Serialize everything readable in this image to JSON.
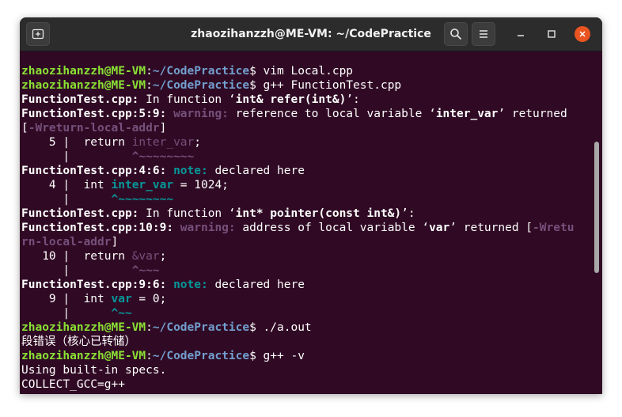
{
  "window": {
    "title": "zhaozihanzzh@ME-VM: ~/CodePractice",
    "icons": [
      "new-tab-icon",
      "search-icon",
      "hamburger-menu-icon",
      "minimize-icon",
      "maximize-icon",
      "close-icon"
    ]
  },
  "colors": {
    "terminal_bg": "#300a24",
    "prompt_user": "#8ae234",
    "prompt_path": "#729fcf",
    "warning": "#75507b",
    "note": "#06989a",
    "close_button": "#e95420"
  },
  "terminal": {
    "lines": [
      [
        {
          "c": "g",
          "t": "zhaozihanzzh@ME-VM"
        },
        {
          "c": "",
          "t": ":"
        },
        {
          "c": "b",
          "t": "~/CodePractice"
        },
        {
          "c": "",
          "t": "$ vim Local.cpp"
        }
      ],
      [
        {
          "c": "g",
          "t": "zhaozihanzzh@ME-VM"
        },
        {
          "c": "",
          "t": ":"
        },
        {
          "c": "b",
          "t": "~/CodePractice"
        },
        {
          "c": "",
          "t": "$ g++ FunctionTest.cpp"
        }
      ],
      [
        {
          "c": "w",
          "t": "FunctionTest.cpp:"
        },
        {
          "c": "",
          "t": " In function ‘"
        },
        {
          "c": "w",
          "t": "int& refer(int&)"
        },
        {
          "c": "",
          "t": "’:"
        }
      ],
      [
        {
          "c": "w",
          "t": "FunctionTest.cpp:5:9:"
        },
        {
          "c": "",
          "t": " "
        },
        {
          "c": "m",
          "t": "warning:"
        },
        {
          "c": "",
          "t": " reference to local variable ‘"
        },
        {
          "c": "w",
          "t": "inter_var"
        },
        {
          "c": "",
          "t": "’ returned"
        }
      ],
      [
        {
          "c": "",
          "t": "["
        },
        {
          "c": "m",
          "t": "-Wreturn-local-addr"
        },
        {
          "c": "",
          "t": "]"
        }
      ],
      [
        {
          "c": "",
          "t": "    5 |  return "
        },
        {
          "c": "pl",
          "t": "inter_var"
        },
        {
          "c": "",
          "t": ";"
        }
      ],
      [
        {
          "c": "",
          "t": "      |         "
        },
        {
          "c": "m",
          "t": "^~~~~~~~~"
        }
      ],
      [
        {
          "c": "w",
          "t": "FunctionTest.cpp:4:6:"
        },
        {
          "c": "",
          "t": " "
        },
        {
          "c": "t",
          "t": "note:"
        },
        {
          "c": "",
          "t": " declared here"
        }
      ],
      [
        {
          "c": "",
          "t": "    4 |  int "
        },
        {
          "c": "t",
          "t": "inter_var"
        },
        {
          "c": "",
          "t": " = 1024;"
        }
      ],
      [
        {
          "c": "",
          "t": "      |      "
        },
        {
          "c": "t",
          "t": "^~~~~~~~~"
        }
      ],
      [
        {
          "c": "w",
          "t": "FunctionTest.cpp:"
        },
        {
          "c": "",
          "t": " In function ‘"
        },
        {
          "c": "w",
          "t": "int* pointer(const int&)"
        },
        {
          "c": "",
          "t": "’:"
        }
      ],
      [
        {
          "c": "w",
          "t": "FunctionTest.cpp:10:9:"
        },
        {
          "c": "",
          "t": " "
        },
        {
          "c": "m",
          "t": "warning:"
        },
        {
          "c": "",
          "t": " address of local variable ‘"
        },
        {
          "c": "w",
          "t": "var"
        },
        {
          "c": "",
          "t": "’ returned ["
        },
        {
          "c": "m",
          "t": "-Wretu"
        }
      ],
      [
        {
          "c": "m",
          "t": "rn-local-addr"
        },
        {
          "c": "",
          "t": "]"
        }
      ],
      [
        {
          "c": "",
          "t": "   10 |  return "
        },
        {
          "c": "pl",
          "t": "&var"
        },
        {
          "c": "",
          "t": ";"
        }
      ],
      [
        {
          "c": "",
          "t": "      |         "
        },
        {
          "c": "m",
          "t": "^~~~"
        }
      ],
      [
        {
          "c": "w",
          "t": "FunctionTest.cpp:9:6:"
        },
        {
          "c": "",
          "t": " "
        },
        {
          "c": "t",
          "t": "note:"
        },
        {
          "c": "",
          "t": " declared here"
        }
      ],
      [
        {
          "c": "",
          "t": "    9 |  int "
        },
        {
          "c": "t",
          "t": "var"
        },
        {
          "c": "",
          "t": " = 0;"
        }
      ],
      [
        {
          "c": "",
          "t": "      |      "
        },
        {
          "c": "t",
          "t": "^~~"
        }
      ],
      [
        {
          "c": "g",
          "t": "zhaozihanzzh@ME-VM"
        },
        {
          "c": "",
          "t": ":"
        },
        {
          "c": "b",
          "t": "~/CodePractice"
        },
        {
          "c": "",
          "t": "$ ./a.out"
        }
      ],
      [
        {
          "c": "",
          "t": "段错误（核心已转储）"
        }
      ],
      [
        {
          "c": "g",
          "t": "zhaozihanzzh@ME-VM"
        },
        {
          "c": "",
          "t": ":"
        },
        {
          "c": "b",
          "t": "~/CodePractice"
        },
        {
          "c": "",
          "t": "$ g++ -v"
        }
      ],
      [
        {
          "c": "",
          "t": "Using built-in specs."
        }
      ],
      [
        {
          "c": "",
          "t": "COLLECT_GCC=g++"
        }
      ]
    ]
  }
}
